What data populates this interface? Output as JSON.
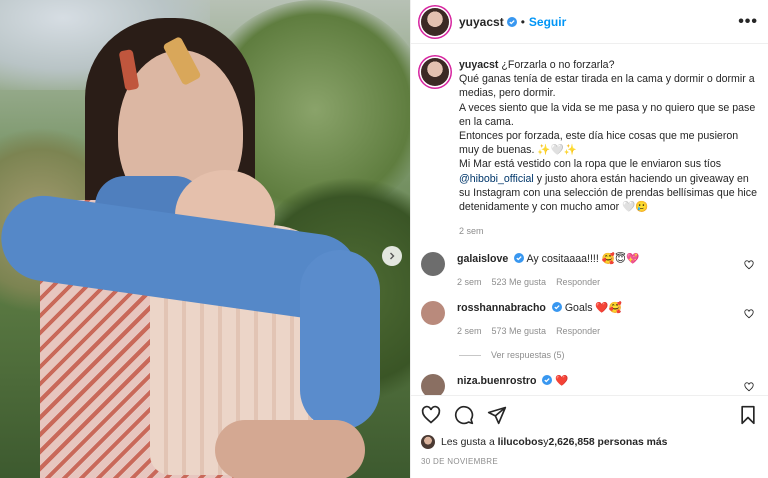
{
  "post_author": {
    "username": "yuyacst",
    "follow_label": "Seguir",
    "dot": "•"
  },
  "caption": {
    "username": "yuyacst",
    "lines": [
      "¿Forzarla o no forzarla?",
      "Qué ganas tenía de estar tirada en la cama y dormir o dormir a medias, pero dormir.",
      "A veces siento que la vida se me pasa y no quiero que se pase en la cama.",
      "Entonces por forzada, este día hice cosas que me pusieron muy de buenas. ✨🤍✨",
      "Mi Mar está vestido con la ropa que le enviaron sus tíos",
      "@hibobi_official",
      " y justo ahora están haciendo un giveaway en su Instagram con una selección de prendas bellísimas que hice detenidamente y con mucho amor 🤍🥲"
    ],
    "time": "2 sem"
  },
  "comments": [
    {
      "username": "galaislove",
      "text": "Ay cositaaaa!!!! 🥰😇💖",
      "time": "2 sem",
      "likes": "523 Me gusta",
      "reply": "Responder",
      "avatar_color": "#6d6d6d"
    },
    {
      "username": "rosshannabracho",
      "text": "Goals ❤️🥰",
      "time": "2 sem",
      "likes": "573 Me gusta",
      "reply": "Responder",
      "avatar_color": "#b98a7c"
    },
    {
      "username": "niza.buenrostro",
      "text": "❤️",
      "time": "",
      "likes": "",
      "reply": "",
      "avatar_color": "#8a6f62"
    }
  ],
  "view_replies": "Ver respuestas (5)",
  "likes_line": {
    "prefix": "Les gusta a ",
    "user": "lilucobos",
    "middle": " y ",
    "count": "2,626,858 personas más"
  },
  "date": "30 DE NOVIEMBRE",
  "colors": {
    "link": "#0095f6",
    "verified": "#3897f0",
    "heart": "#ed4956"
  },
  "icons": [
    "verified-icon",
    "more-icon",
    "heart-icon",
    "comment-icon",
    "share-icon",
    "bookmark-icon",
    "chevron-right-icon"
  ]
}
